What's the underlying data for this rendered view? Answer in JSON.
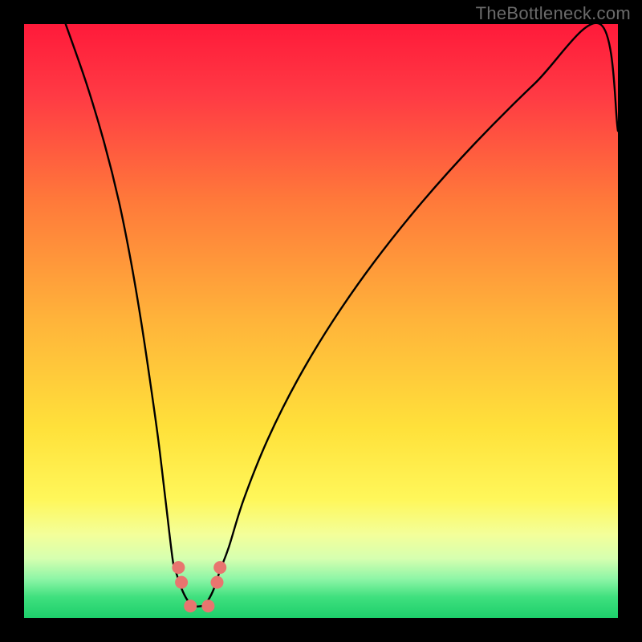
{
  "attribution": "TheBottleneck.com",
  "chart_data": {
    "type": "line",
    "title": "",
    "xlabel": "",
    "ylabel": "",
    "xlim": [
      0,
      100
    ],
    "ylim": [
      0,
      100
    ],
    "grid": false,
    "legend": false,
    "annotations": [],
    "background_gradient_stops": [
      {
        "pos": 0.0,
        "color": "#ff1a3a"
      },
      {
        "pos": 0.12,
        "color": "#ff3a44"
      },
      {
        "pos": 0.3,
        "color": "#ff7a3a"
      },
      {
        "pos": 0.5,
        "color": "#ffb43a"
      },
      {
        "pos": 0.68,
        "color": "#ffe13a"
      },
      {
        "pos": 0.8,
        "color": "#fff75a"
      },
      {
        "pos": 0.86,
        "color": "#f3ff9a"
      },
      {
        "pos": 0.9,
        "color": "#d6ffb0"
      },
      {
        "pos": 0.935,
        "color": "#8cf5a6"
      },
      {
        "pos": 0.965,
        "color": "#3fe07e"
      },
      {
        "pos": 1.0,
        "color": "#1dcf6b"
      }
    ],
    "series": [
      {
        "name": "left-curve",
        "x": [
          7.0,
          10.5,
          13.5,
          16.0,
          18.0,
          19.7,
          21.2,
          22.6,
          23.8,
          25.0,
          25.5,
          26.5,
          27.5,
          28.5,
          30.0
        ],
        "values": [
          100,
          90.0,
          80.0,
          70.0,
          60.0,
          50.0,
          40.0,
          30.0,
          20.0,
          10.0,
          8.0,
          5.0,
          3.0,
          2.0,
          2.0
        ]
      },
      {
        "name": "right-curve",
        "x": [
          30.0,
          31.0,
          32.0,
          33.0,
          34.5,
          37.0,
          41.0,
          46.0,
          52.0,
          59.0,
          67.0,
          76.0,
          86.0,
          97.0,
          100.0
        ],
        "values": [
          2.0,
          3.0,
          5.0,
          8.0,
          12.0,
          20.0,
          30.0,
          40.0,
          50.0,
          60.0,
          70.0,
          80.0,
          90.0,
          100.0,
          82.0
        ]
      }
    ],
    "markers": [
      {
        "name": "left-elbow-top",
        "x": 26.0,
        "y": 8.5
      },
      {
        "name": "left-elbow-bottom",
        "x": 26.5,
        "y": 6.0
      },
      {
        "name": "right-elbow-top",
        "x": 33.0,
        "y": 8.5
      },
      {
        "name": "right-elbow-bottom",
        "x": 32.5,
        "y": 6.0
      },
      {
        "name": "valley-left",
        "x": 28.0,
        "y": 2.0
      },
      {
        "name": "valley-right",
        "x": 31.0,
        "y": 2.0
      }
    ],
    "marker_color": "#e8756f",
    "marker_radius": 8
  }
}
